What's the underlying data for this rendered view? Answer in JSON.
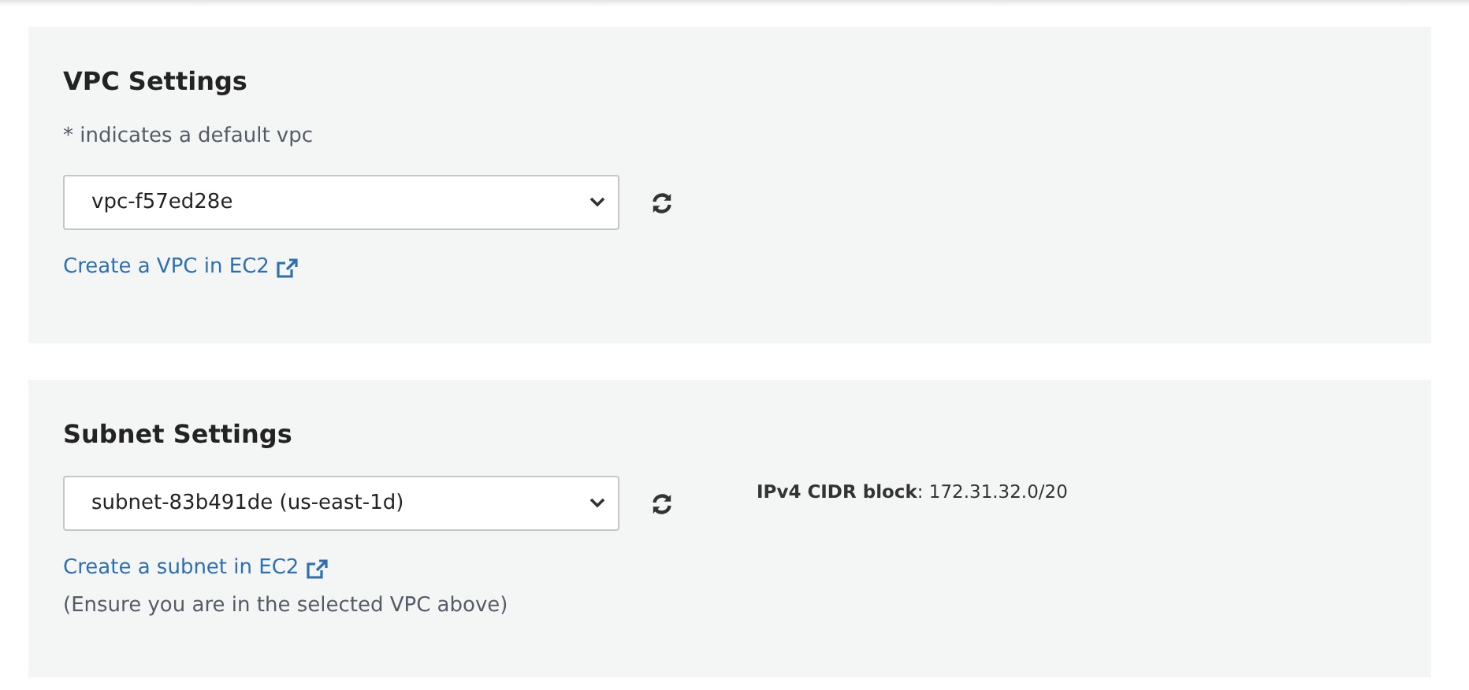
{
  "sections": [
    {
      "title": "VPC Settings",
      "hint": "* indicates a default vpc",
      "select": {
        "value": "vpc-f57ed28e"
      },
      "link": "Create a VPC in EC2"
    },
    {
      "title": "Subnet Settings",
      "select": {
        "value": "subnet-83b491de (us-east-1d)"
      },
      "link": "Create a subnet in EC2",
      "info": "**IPv4 CIDR block**: 172.31.32.0/20",
      "note": "(Ensure you are in the selected VPC above)"
    }
  ]
}
